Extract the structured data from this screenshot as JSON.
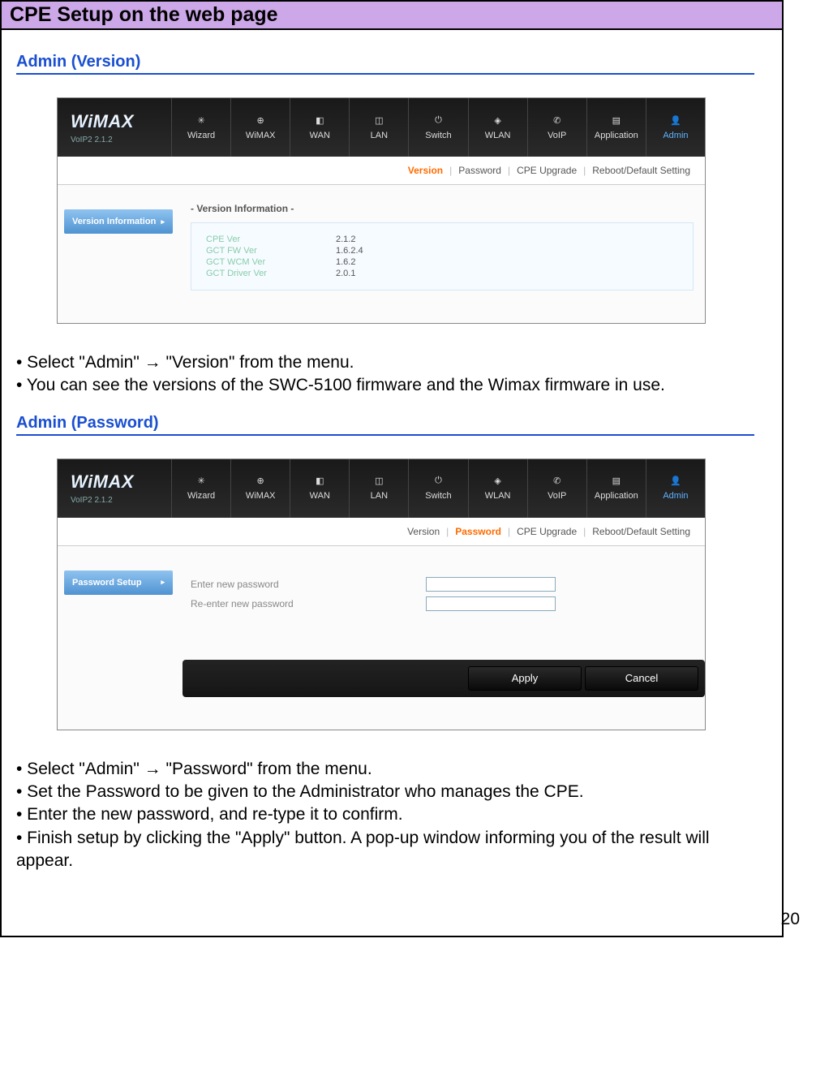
{
  "page": {
    "banner": "CPE Setup on the web page",
    "page_number": "20"
  },
  "sections": {
    "version": {
      "heading": "Admin (Version)",
      "bullets": [
        "• Select \"Admin\" → \"Version\" from the menu.",
        "• You can see the versions of the SWC-5100 firmware and the Wimax firmware in use."
      ]
    },
    "password": {
      "heading": "Admin (Password)",
      "bullets": [
        "• Select \"Admin\" → \"Password\" from the menu.",
        "• Set the Password to be given to the Administrator who manages the CPE.",
        "• Enter the new password, and re-type it to confirm.",
        "• Finish setup by clicking the \"Apply\" button. A pop-up window informing you of the result will appear."
      ]
    }
  },
  "screenshot_common": {
    "logo": "WiMAX",
    "logo_sub": "VoIP2 2.1.2",
    "nav": [
      "Wizard",
      "WiMAX",
      "WAN",
      "LAN",
      "Switch",
      "WLAN",
      "VoIP",
      "Application",
      "Admin"
    ],
    "subnav": [
      "Version",
      "Password",
      "CPE Upgrade",
      "Reboot/Default Setting"
    ]
  },
  "version_panel": {
    "side_button": "Version Information",
    "group_title": "Version Information",
    "rows": [
      {
        "label": "CPE Ver",
        "value": "2.1.2"
      },
      {
        "label": "GCT FW Ver",
        "value": "1.6.2.4"
      },
      {
        "label": "GCT WCM Ver",
        "value": "1.6.2"
      },
      {
        "label": "GCT Driver Ver",
        "value": "2.0.1"
      }
    ]
  },
  "password_panel": {
    "side_button": "Password Setup",
    "fields": [
      {
        "label": "Enter new password"
      },
      {
        "label": "Re-enter new password"
      }
    ],
    "buttons": {
      "apply": "Apply",
      "cancel": "Cancel"
    }
  }
}
